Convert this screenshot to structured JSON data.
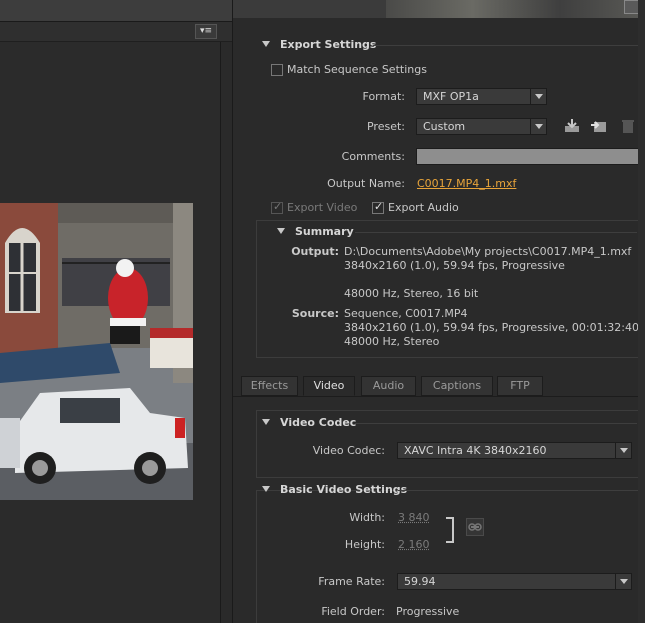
{
  "export_settings": {
    "heading": "Export Settings",
    "match_sequence_label": "Match Sequence Settings",
    "format_label": "Format:",
    "format_value": "MXF OP1a",
    "preset_label": "Preset:",
    "preset_value": "Custom",
    "comments_label": "Comments:",
    "comments_value": "",
    "output_name_label": "Output Name:",
    "output_name_value": "C0017.MP4_1.mxf",
    "export_video_label": "Export Video",
    "export_audio_label": "Export Audio"
  },
  "summary": {
    "heading": "Summary",
    "output_label": "Output:",
    "output_lines": [
      "D:\\Documents\\Adobe\\My projects\\C0017.MP4_1.mxf",
      "3840x2160 (1.0), 59.94 fps, Progressive",
      "48000 Hz, Stereo, 16 bit"
    ],
    "source_label": "Source:",
    "source_lines": [
      "Sequence, C0017.MP4",
      "3840x2160 (1.0), 59.94 fps, Progressive, 00:01:32:40",
      "48000 Hz, Stereo"
    ]
  },
  "tabs": [
    "Effects",
    "Video",
    "Audio",
    "Captions",
    "FTP"
  ],
  "video_codec": {
    "heading": "Video Codec",
    "label": "Video Codec:",
    "value": "XAVC Intra 4K 3840x2160"
  },
  "basic_video": {
    "heading": "Basic Video Settings",
    "width_label": "Width:",
    "width_value": "3 840",
    "height_label": "Height:",
    "height_value": "2 160",
    "frame_rate_label": "Frame Rate:",
    "frame_rate_value": "59.94",
    "field_order_label": "Field Order:",
    "field_order_value": "Progressive"
  },
  "icons": {
    "panel_menu": "panel-menu-icon",
    "save_preset": "save-preset-icon",
    "import_preset": "import-preset-icon",
    "delete_preset": "delete-preset-icon",
    "link": "chain-link-icon"
  },
  "colors": {
    "accent_link": "#e8a43a",
    "panel_bg": "#2a2a2a"
  }
}
